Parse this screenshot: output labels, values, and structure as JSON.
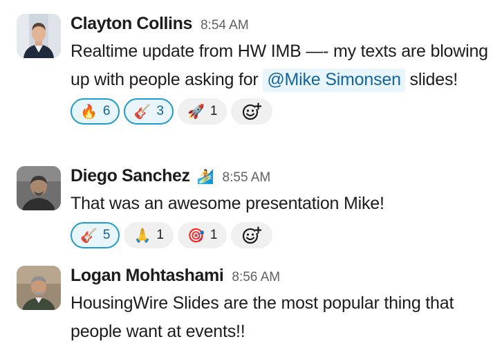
{
  "messages": [
    {
      "author": "Clayton Collins",
      "time": "8:54 AM",
      "text_before_mention": "Realtime update from HW IMB —- my texts are blowing up with people asking for ",
      "mention": "@Mike Simonsen",
      "text_after_mention": " slides!",
      "reactions": [
        {
          "emoji": "🔥",
          "icon": "fire-icon",
          "count": "6",
          "active": true
        },
        {
          "emoji": "🎸",
          "icon": "guitar-icon",
          "count": "3",
          "active": true
        },
        {
          "emoji": "🚀",
          "icon": "rocket-icon",
          "count": "1",
          "active": false
        }
      ]
    },
    {
      "author": "Diego Sanchez",
      "status_emoji": "🏄",
      "time": "8:55 AM",
      "text": "That was an awesome presentation Mike!",
      "reactions": [
        {
          "emoji": "🎸",
          "icon": "guitar-icon",
          "count": "5",
          "active": true
        },
        {
          "emoji": "🙏",
          "icon": "praying-hands-icon",
          "count": "1",
          "active": false
        },
        {
          "emoji": "🎯",
          "icon": "target-icon",
          "count": "1",
          "active": false
        }
      ]
    },
    {
      "author": "Logan Mohtashami",
      "time": "8:56 AM",
      "text": "HousingWire Slides are the most popular thing that people want at events!!"
    }
  ],
  "colors": {
    "mention_bg": "#e8f5fa",
    "mention_text": "#1264a3",
    "active_reaction_border": "#1d9bd1",
    "reaction_bg": "#f0f0f0"
  }
}
